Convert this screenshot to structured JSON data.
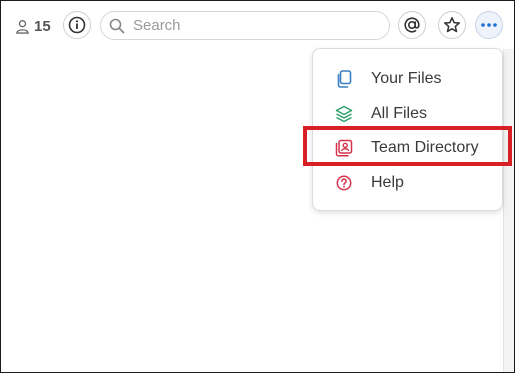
{
  "topbar": {
    "member_count": "15",
    "search_placeholder": "Search"
  },
  "icons": {
    "members": "person-icon",
    "info": "info-icon",
    "search": "search-icon",
    "mention": "at-sign-icon",
    "star": "star-icon",
    "more": "ellipsis-icon"
  },
  "menu": {
    "items": [
      {
        "label": "Your Files",
        "icon": "file-stack-icon",
        "color": "#3b7fc4"
      },
      {
        "label": "All Files",
        "icon": "layers-icon",
        "color": "#2e9e6b"
      },
      {
        "label": "Team Directory",
        "icon": "contact-card-icon",
        "color": "#d6334a"
      },
      {
        "label": "Help",
        "icon": "help-circle-icon",
        "color": "#d6334a"
      }
    ]
  },
  "colors": {
    "highlight": "#d81f26",
    "more_button_dots": "#1d6fd6"
  }
}
